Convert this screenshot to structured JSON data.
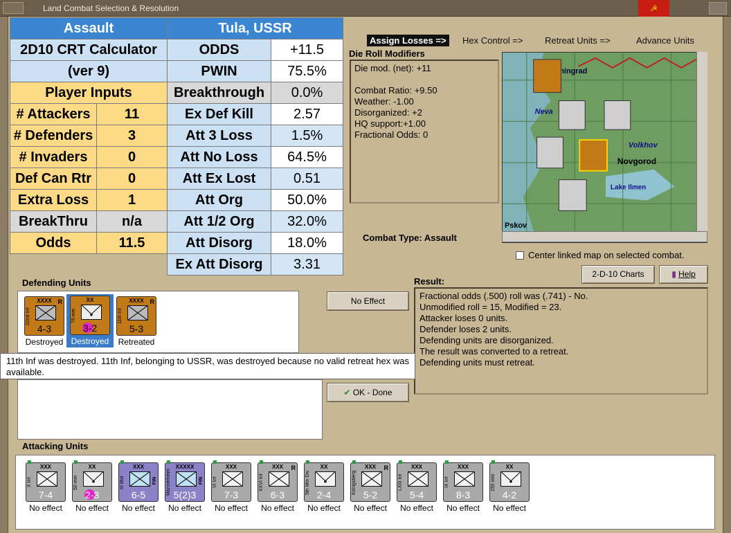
{
  "window": {
    "title": "Land Combat Selection & Resolution"
  },
  "phases": {
    "assign": "Assign Losses =>",
    "hex": "Hex Control =>",
    "retreat": "Retreat Units =>",
    "advance": "Advance Units"
  },
  "calc": {
    "title_left": "Assault",
    "title_right": "Tula, USSR",
    "calc_name": "2D10 CRT Calculator",
    "version": "(ver 9)",
    "player_inputs": "Player Inputs",
    "rows_left": [
      {
        "label": "# Attackers",
        "value": "11"
      },
      {
        "label": "# Defenders",
        "value": "3"
      },
      {
        "label": "# Invaders",
        "value": "0"
      },
      {
        "label": "Def Can Rtr",
        "value": "0"
      },
      {
        "label": "Extra Loss",
        "value": "1"
      },
      {
        "label": "BreakThru",
        "value": "n/a"
      },
      {
        "label": "Odds",
        "value": "11.5"
      }
    ],
    "rows_right": [
      {
        "label": "ODDS",
        "value": "+11.5"
      },
      {
        "label": "PWIN",
        "value": "75.5%"
      },
      {
        "label": "Breakthrough",
        "value": "0.0%"
      },
      {
        "label": "Ex Def Kill",
        "value": "2.57"
      },
      {
        "label": "Att 3 Loss",
        "value": "1.5%"
      },
      {
        "label": "Att No Loss",
        "value": "64.5%"
      },
      {
        "label": "Att Ex Lost",
        "value": "0.51"
      },
      {
        "label": "Att Org",
        "value": "50.0%"
      },
      {
        "label": "Att 1/2 Org",
        "value": "32.0%"
      },
      {
        "label": "Att Disorg",
        "value": "18.0%"
      },
      {
        "label": "Ex Att Disorg",
        "value": "3.31"
      }
    ]
  },
  "drm": {
    "title": "Die Roll Modifiers",
    "lines": [
      "Die mod. (net): +11",
      "",
      "Combat Ratio: +9.50",
      "Weather: -1.00",
      "Disorganized: +2",
      "HQ support:+1.00",
      "Fractional Odds: 0"
    ]
  },
  "combat_type": "Combat Type:  Assault",
  "map": {
    "labels": [
      "Leningrad",
      "Neva",
      "Volkhov",
      "Novgorod",
      "Lake Ilmen",
      "Pskov"
    ],
    "center_linked": "Center linked map on selected combat."
  },
  "buttons": {
    "charts": "2-D-10 Charts",
    "help": "Help",
    "no_effect": "No Effect",
    "ok": "OK - Done"
  },
  "result": {
    "title": "Result:",
    "lines": [
      "Fractional odds (.500) roll was (.741)  - No.",
      "Unmodified roll = 15, Modified = 23.",
      "Attacker loses 0 units.",
      "Defender loses 2 units.",
      "Defending units are disorganized.",
      "The result was converted to a retreat.",
      "Defending units must retreat."
    ]
  },
  "defending": {
    "title": "Defending Units",
    "units": [
      {
        "name": "22nd Inf",
        "size": "XXXX",
        "strength": "4-3",
        "status": "Destroyed",
        "r": "R"
      },
      {
        "name": "76 mm",
        "size": "XX",
        "strength": "3-2",
        "status": "Destroyed",
        "r": ""
      },
      {
        "name": "11th Inf",
        "size": "XXXX",
        "strength": "5-3",
        "status": "Retreated",
        "r": "R"
      }
    ]
  },
  "tooltip": "11th Inf was destroyed.  11th Inf, belonging to USSR, was destroyed because no valid retreat hex was available.",
  "attacking": {
    "title": "Attacking Units",
    "units": [
      {
        "name": "X Inf",
        "size": "XXX",
        "strength": "7-4",
        "status": "No effect"
      },
      {
        "name": "50 mm",
        "size": "XX",
        "strength": "2-3",
        "status": "No effect"
      },
      {
        "name": "III Mot",
        "size": "XXX",
        "strength": "6-5",
        "status": "No effect",
        "fin": "FIN"
      },
      {
        "name": "Mannerheim",
        "size": "XXXXX",
        "strength": "5(2)3",
        "status": "No effect",
        "fin": "FIN"
      },
      {
        "name": "VI Inf",
        "size": "XXX",
        "strength": "7-3",
        "status": "No effect"
      },
      {
        "name": "XXVI Inf",
        "size": "XXX",
        "strength": "6-3",
        "status": "No effect",
        "r": "R"
      },
      {
        "name": "5th Mtn Div",
        "size": "XX",
        "strength": "2-4",
        "status": "No effect"
      },
      {
        "name": "Königsberg",
        "size": "XXX",
        "strength": "5-2",
        "status": "No effect",
        "r": "R"
      },
      {
        "name": "LXIII Inf",
        "size": "XXX",
        "strength": "5-4",
        "status": "No effect"
      },
      {
        "name": "IX Inf",
        "size": "XXX",
        "strength": "8-3",
        "status": "No effect"
      },
      {
        "name": "150 mm",
        "size": "XX",
        "strength": "4-2",
        "status": "No effect"
      }
    ]
  }
}
